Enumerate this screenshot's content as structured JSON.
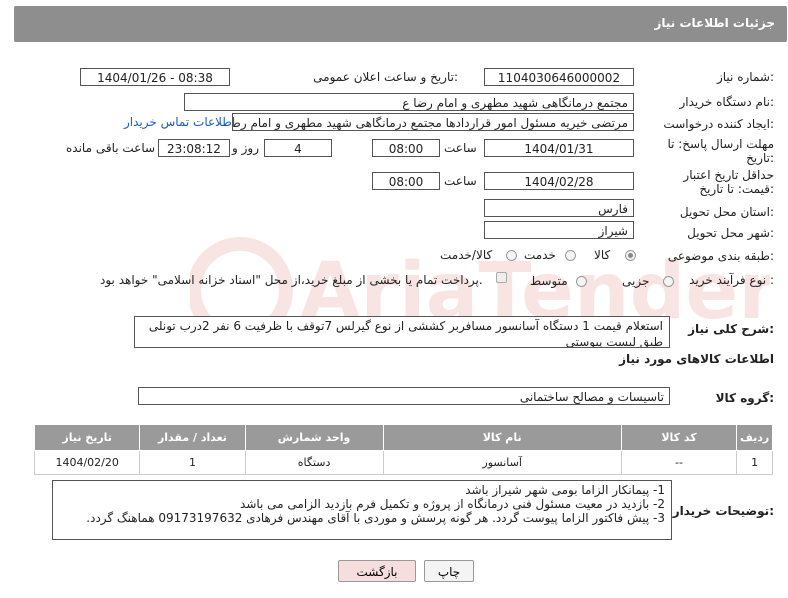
{
  "header": {
    "title": "جزئیات اطلاعات نیاز"
  },
  "form": {
    "need_number": {
      "label": "شماره نیاز:",
      "value": "1104030646000002"
    },
    "announce_datetime": {
      "label": "تاریخ و ساعت اعلان عمومی:",
      "value": "1404/01/26 - 08:38"
    },
    "buyer_org": {
      "label": "نام دستگاه خریدار:",
      "value": "مجتمع درمانگاهی شهید مطهری و امام رضا  ع"
    },
    "requester": {
      "label": "ایجاد کننده درخواست:",
      "value": "مرتضی خیریه مسئول امور قراردادها مجتمع درمانگاهی شهید مطهری و امام رضا",
      "contact_link": "اطلاعات تماس خریدار"
    },
    "reply_deadline": {
      "label": "مهلت ارسال پاسخ: تا تاریخ:",
      "date": "1404/01/31",
      "time_label": "ساعت",
      "time": "08:00",
      "days": "4",
      "days_label": "روز و",
      "remaining": "23:08:12",
      "remaining_label": "ساعت باقی مانده"
    },
    "price_validity": {
      "label": "حداقل تاریخ اعتبار قیمت: تا تاریخ:",
      "date": "1404/02/28",
      "time_label": "ساعت",
      "time": "08:00"
    },
    "province": {
      "label": "استان محل تحویل:",
      "value": "فارس"
    },
    "city": {
      "label": "شهر محل تحویل:",
      "value": "شیراز"
    },
    "category": {
      "label": "طبقه بندی موضوعی:",
      "options": [
        "کالا",
        "خدمت",
        "کالا/خدمت"
      ],
      "selected": "کالا"
    },
    "purchase_type": {
      "label": "نوع فرآیند خرید :",
      "options": [
        "جزیی",
        "متوسط"
      ],
      "selected": "",
      "payment_note": "پرداخت تمام یا بخشی از مبلغ خرید،از محل \"اسناد خزانه اسلامی\" خواهد بود."
    }
  },
  "description": {
    "label": "شرح کلی نیاز:",
    "text": "استعلام قیمت 1 دستگاه آسانسور مسافربر کششی از نوع  گیرلس 7توقف با ظرفیت 6 نفر 2درب تونلی طبق لیست پیوستی"
  },
  "goods_section": {
    "title": "اطلاعات کالاهای مورد نیاز",
    "group_label": "گروه کالا:",
    "group_value": "تاسیسات و مصالح ساختمانی",
    "columns": [
      "ردیف",
      "کد کالا",
      "نام کالا",
      "واحد شمارش",
      "تعداد / مقدار",
      "تاریخ نیاز"
    ],
    "rows": [
      {
        "row": "1",
        "code": "--",
        "name": "آسانسور",
        "unit": "دستگاه",
        "qty": "1",
        "date": "1404/02/20"
      }
    ]
  },
  "buyer_notes": {
    "label": "توضیحات خریدار:",
    "lines": [
      "1- پیمانکار الزاما بومی شهر شیراز باشد",
      "2- بازدید در معیت مسئول فنی درمانگاه از پروژه و تکمیل فرم بازدید الزامی می باشد",
      "3- پیش فاکتور الزاما پیوست گردد. هر گونه پرسش و موردی با آقای مهندس فرهادی 09173197632 هماهنگ گردد."
    ]
  },
  "buttons": {
    "print": "چاپ",
    "back": "بازگشت"
  },
  "colors": {
    "header_bg": "#8e8e8e",
    "table_header_bg": "#9a9a9a",
    "link": "#1a5fb4",
    "back_button_bg": "#f6dede"
  },
  "watermark_text": "AriaTender.neT"
}
